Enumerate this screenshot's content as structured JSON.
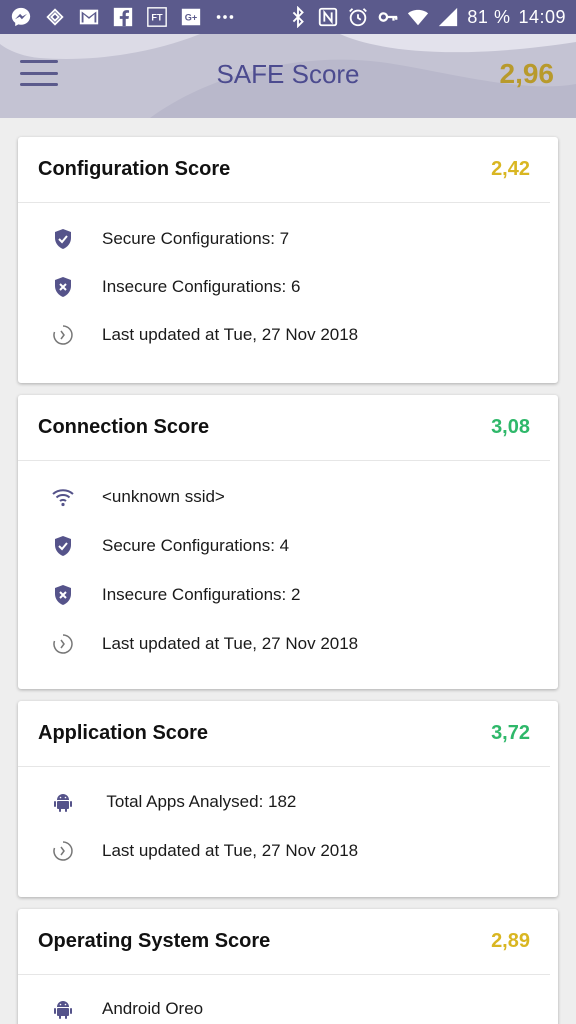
{
  "status_bar": {
    "battery": "81 %",
    "time": "14:09",
    "icons": [
      "messenger-icon",
      "sync-icon",
      "gmail-icon",
      "facebook-icon",
      "ft-icon",
      "google-plus-icon",
      "more-icon",
      "bluetooth-icon",
      "nfc-icon",
      "alarm-icon",
      "key-icon",
      "wifi-icon",
      "signal-icon",
      "battery-icon"
    ]
  },
  "appbar": {
    "title": "SAFE Score",
    "score": "2,96",
    "score_color": "#b89a2c",
    "background": "#c4c3d3"
  },
  "colors": {
    "accent": "#5b5a8c",
    "score_yellow": "#d9b622",
    "score_green": "#2fb86a"
  },
  "cards": [
    {
      "title": "Configuration Score",
      "score": "2,42",
      "score_color": "yellow",
      "rows": [
        {
          "icon": "shield-check-icon",
          "text": "Secure Configurations: 7"
        },
        {
          "icon": "shield-x-icon",
          "text": "Insecure Configurations: 6"
        },
        {
          "icon": "update-clock-icon",
          "text": "Last updated at Tue, 27 Nov 2018"
        }
      ]
    },
    {
      "title": "Connection Score",
      "score": "3,08",
      "score_color": "green",
      "rows": [
        {
          "icon": "wifi-icon",
          "text": "<unknown ssid>"
        },
        {
          "icon": "shield-check-icon",
          "text": "Secure Configurations: 4"
        },
        {
          "icon": "shield-x-icon",
          "text": "Insecure Configurations: 2"
        },
        {
          "icon": "update-clock-icon",
          "text": "Last updated at Tue, 27 Nov 2018"
        }
      ]
    },
    {
      "title": "Application Score",
      "score": "3,72",
      "score_color": "green",
      "rows": [
        {
          "icon": "android-icon",
          "text": " Total Apps Analysed: 182"
        },
        {
          "icon": "update-clock-icon",
          "text": "Last updated at Tue, 27 Nov 2018"
        }
      ]
    },
    {
      "title": "Operating System Score",
      "score": "2,89",
      "score_color": "yellow",
      "rows": [
        {
          "icon": "android-icon",
          "text": "Android Oreo"
        }
      ]
    }
  ]
}
